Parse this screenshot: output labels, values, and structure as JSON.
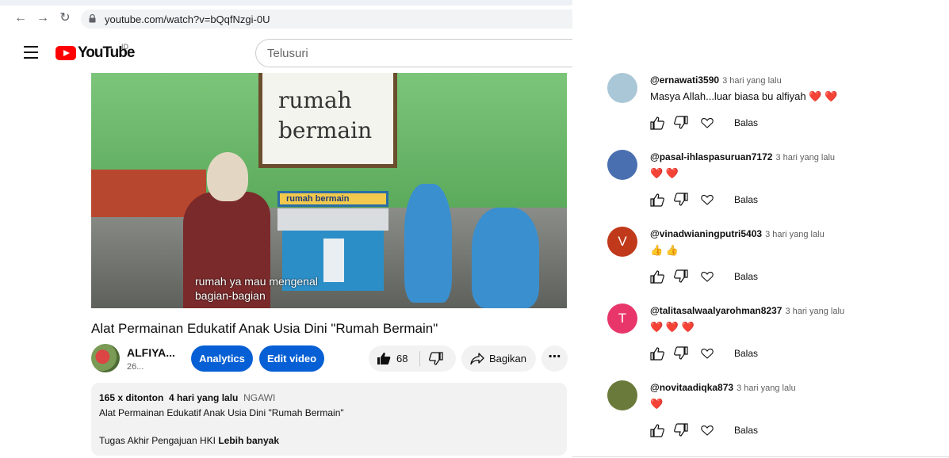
{
  "browser": {
    "url": "youtube.com/watch?v=bQqfNzgi-0U"
  },
  "header": {
    "logo_text": "YouTube",
    "region": "ID",
    "search_placeholder": "Telusuri"
  },
  "video": {
    "board_line1": "rumah",
    "board_line2": "bermain",
    "house_sign": "rumah bermain",
    "caption_line1": "rumah ya mau mengenal",
    "caption_line2": "bagian-bagian",
    "title": "Alat Permainan Edukatif Anak Usia Dini \"Rumah Bermain\""
  },
  "channel": {
    "name": "ALFIYA...",
    "subs": "26..."
  },
  "actions": {
    "analytics_label": "Analytics",
    "edit_label": "Edit video",
    "like_count": "68",
    "share_label": "Bagikan",
    "more_label": "⋯"
  },
  "description": {
    "views": "165 x ditonton",
    "date": "4 hari yang lalu",
    "location": "NGAWI",
    "line2": "Alat Permainan Edukatif Anak Usia Dini \"Rumah Bermain\"",
    "line3": "Tugas Akhir Pengajuan HKI",
    "more_label": "Lebih banyak"
  },
  "comments": [
    {
      "author": "@ernawati3590",
      "time": "3 hari yang lalu",
      "text": "Masya Allah...luar biasa  bu alfiyah ❤️ ❤️",
      "avatar_letter": "",
      "avatar_color": "#a9c7d6",
      "reply": "Balas"
    },
    {
      "author": "@pasal-ihlaspasuruan7172",
      "time": "3 hari yang lalu",
      "text": "❤️ ❤️",
      "avatar_letter": "",
      "avatar_color": "#4a6fb0",
      "reply": "Balas"
    },
    {
      "author": "@vinadwianingputri5403",
      "time": "3 hari yang lalu",
      "text": "👍 👍",
      "avatar_letter": "V",
      "avatar_color": "#c0391b",
      "reply": "Balas"
    },
    {
      "author": "@talitasalwaalyarohman8237",
      "time": "3 hari yang lalu",
      "text": "❤️ ❤️ ❤️",
      "avatar_letter": "T",
      "avatar_color": "#e8366b",
      "reply": "Balas"
    },
    {
      "author": "@novitaadiqka873",
      "time": "3 hari yang lalu",
      "text": "❤️",
      "avatar_letter": "",
      "avatar_color": "#6a7a3a",
      "reply": "Balas"
    }
  ]
}
